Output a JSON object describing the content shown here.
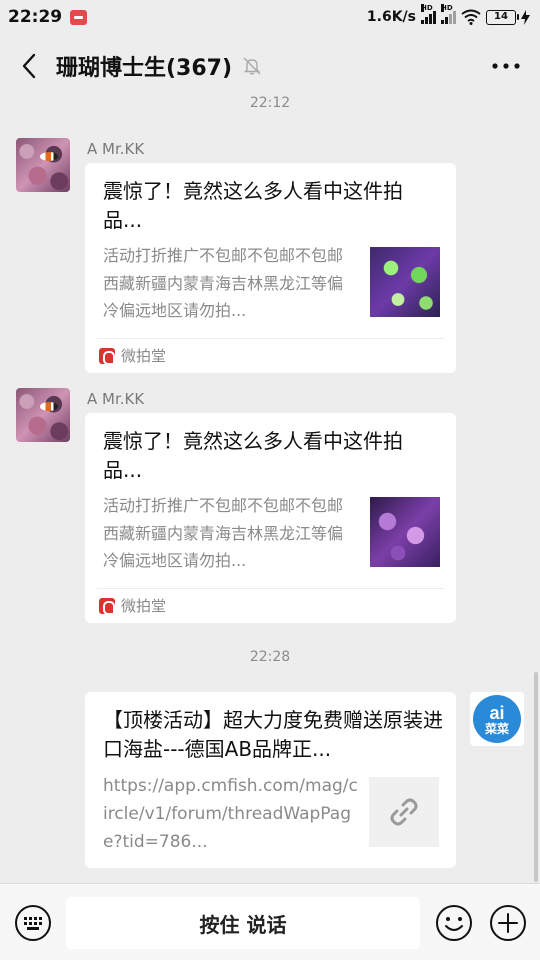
{
  "status_bar": {
    "time": "22:29",
    "network_speed": "1.6K/s",
    "signal_label_1": "HD",
    "signal_label_2": "HD",
    "battery": "14"
  },
  "header": {
    "back_icon": "chevron-left-icon",
    "title": "珊瑚博士生(367)",
    "mute_icon": "bell-off-icon",
    "more_icon": "more-dots-icon"
  },
  "messages": [
    {
      "time_label": "22:12",
      "sender": "A  Mr.KK",
      "title": "震惊了！竟然这么多人看中这件拍品...",
      "description": "活动打折推广不包邮不包邮不包邮西藏新疆内蒙青海吉林黑龙江等偏冷偏远地区请勿拍...",
      "source": "微拍堂"
    },
    {
      "sender": "A  Mr.KK",
      "title": "震惊了！竟然这么多人看中这件拍品...",
      "description": "活动打折推广不包邮不包邮不包邮西藏新疆内蒙青海吉林黑龙江等偏冷偏远地区请勿拍...",
      "source": "微拍堂"
    },
    {
      "time_label": "22:28",
      "title": "【顶楼活动】超大力度免费赠送原装进口海盐---德国AB品牌正...",
      "url": "https://app.cmfish.com/mag/circle/v1/forum/threadWapPage?tid=786...",
      "avatar_text_top": "ai",
      "avatar_text_bottom": "菜菜"
    }
  ],
  "input_bar": {
    "voice_label": "按住 说话",
    "keyboard_icon": "keyboard-icon",
    "emoji_icon": "emoji-icon",
    "plus_icon": "plus-circle-icon"
  },
  "colors": {
    "background": "#ededed",
    "card": "#ffffff",
    "source_brand": "#d9352e",
    "ai_avatar": "#2a8ad8"
  }
}
